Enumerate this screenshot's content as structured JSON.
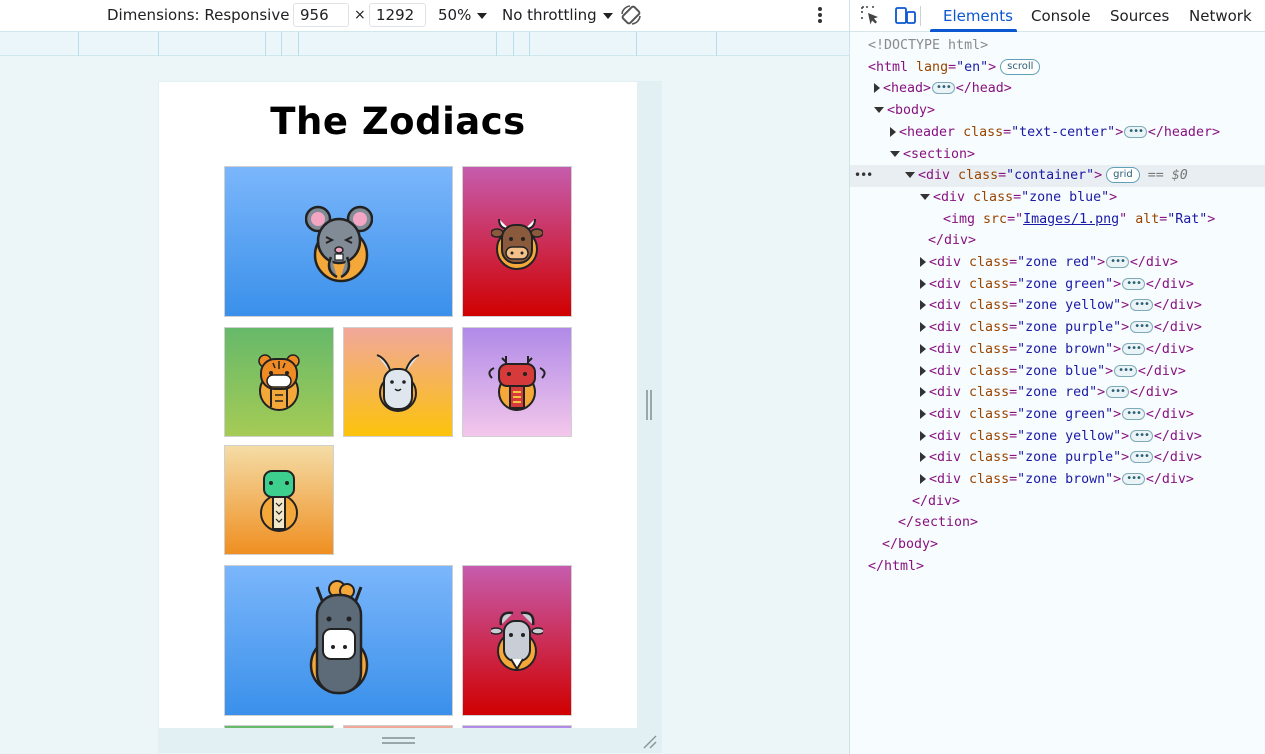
{
  "device_toolbar": {
    "dimensions_label": "Dimensions: Responsive",
    "width_value": "956",
    "times": "×",
    "height_value": "1292",
    "zoom": "50%",
    "throttling": "No throttling"
  },
  "page": {
    "title": "The Zodiacs",
    "tiles": [
      {
        "animal": "rat",
        "color": "blue"
      },
      {
        "animal": "ox",
        "color": "red"
      },
      {
        "animal": "tiger",
        "color": "green"
      },
      {
        "animal": "rabbit",
        "color": "yellow"
      },
      {
        "animal": "dragon",
        "color": "purple"
      },
      {
        "animal": "snake",
        "color": "brown"
      },
      {
        "animal": "horse",
        "color": "blue"
      },
      {
        "animal": "goat",
        "color": "red"
      }
    ]
  },
  "devtools": {
    "tabs": [
      "Elements",
      "Console",
      "Sources",
      "Network"
    ],
    "active_tab": "Elements",
    "dom": {
      "doctype": "<!DOCTYPE html>",
      "html_open": "<html",
      "lang_attr": "lang",
      "lang_val": "\"en\"",
      "scroll_badge": "scroll",
      "head": "<head>",
      "head_close": "</head>",
      "body": "<body>",
      "header_open": "<header",
      "class_attr": "class",
      "header_class": "\"text-center\"",
      "header_close": "</header>",
      "section": "<section>",
      "div_open": "<div",
      "container_class": "\"container\"",
      "grid_badge": "grid",
      "selected_marker": "== $0",
      "img_open": "<img",
      "src_attr": "src",
      "src_val": "Images/1.png",
      "alt_attr": "alt",
      "alt_val": "\"Rat\"",
      "div_close": "</div>",
      "section_close": "</section>",
      "body_close": "</body>",
      "html_close": "</html>",
      "zone_classes": [
        "\"zone blue\"",
        "\"zone red\"",
        "\"zone green\"",
        "\"zone yellow\"",
        "\"zone purple\"",
        "\"zone brown\"",
        "\"zone blue\"",
        "\"zone red\"",
        "\"zone green\"",
        "\"zone yellow\"",
        "\"zone purple\"",
        "\"zone brown\""
      ]
    }
  },
  "colors": {
    "blue": [
      "#7bb6fb",
      "#3a90ea"
    ],
    "red": [
      "#c65cae",
      "#d00000"
    ],
    "green": [
      "#66b96a",
      "#a5cb55"
    ],
    "yellow": [
      "#f1a79b",
      "#fcc30b"
    ],
    "purple": [
      "#b08ae8",
      "#f3c7eb"
    ],
    "brown": [
      "#f4dca6",
      "#ef8f21"
    ],
    "devtools_accent": "#0b57d0"
  }
}
